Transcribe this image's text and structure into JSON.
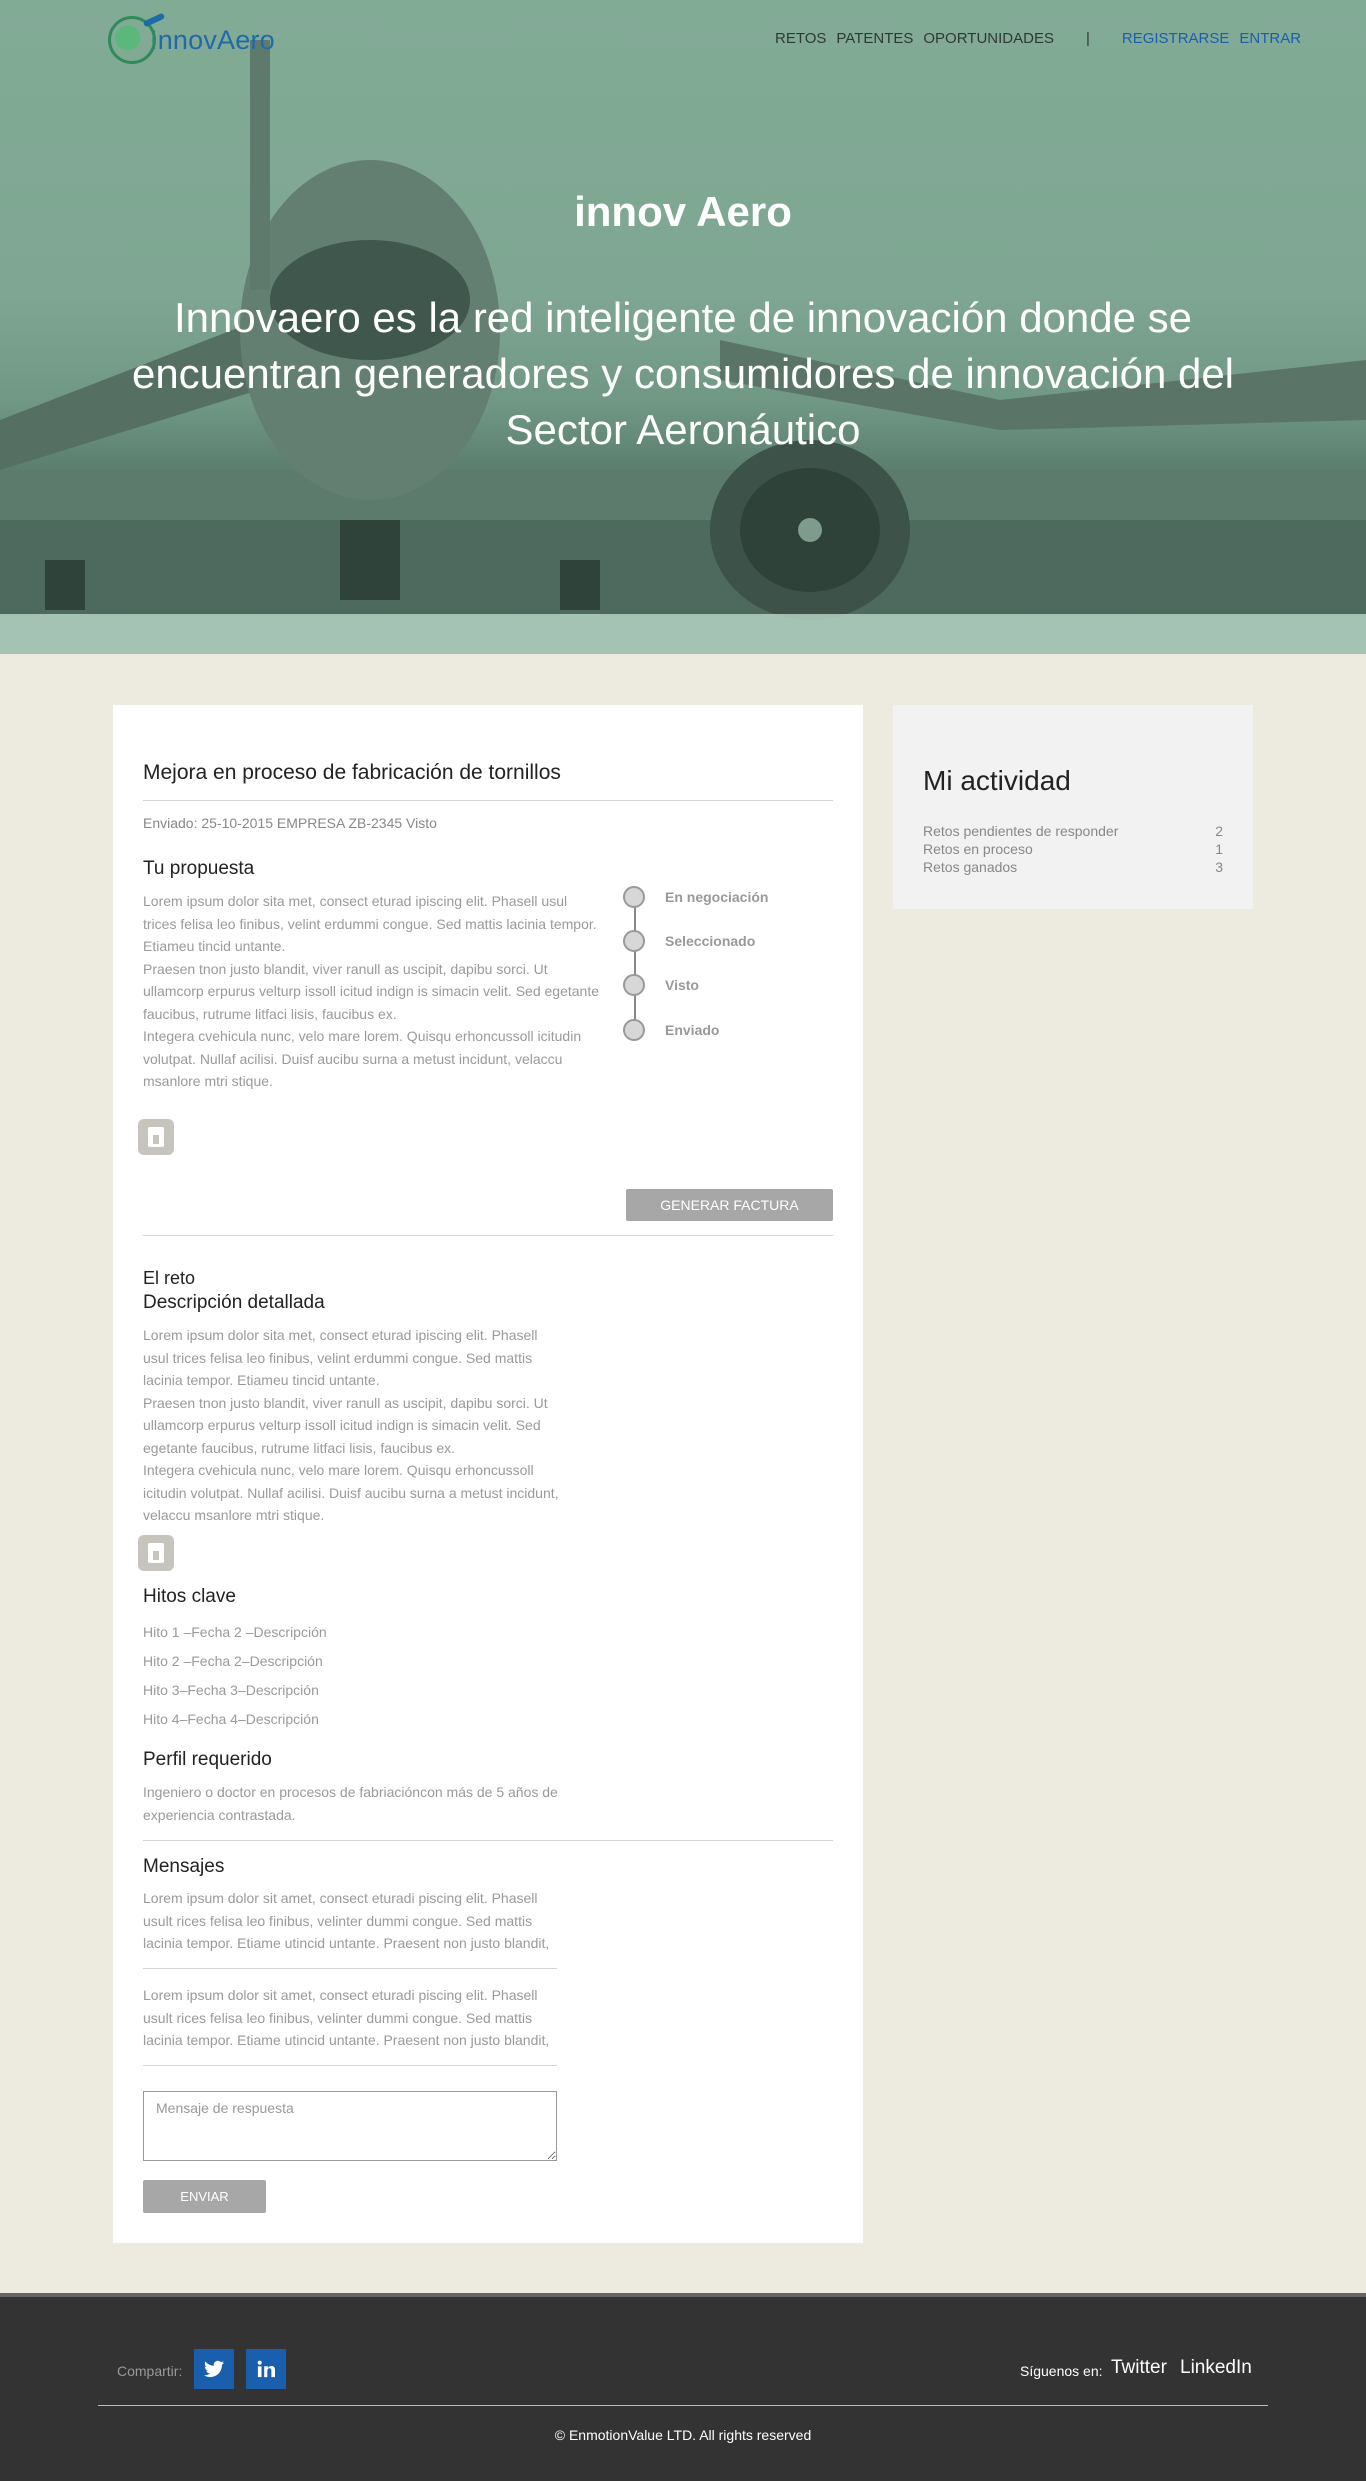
{
  "brand": {
    "logo_text": "InnovAero"
  },
  "nav": {
    "items": [
      "RETOS",
      "PATENTES",
      "OPORTUNIDADES"
    ],
    "separator": "|",
    "register": "REGISTRARSE",
    "login": "ENTRAR"
  },
  "hero": {
    "title": "innov Aero",
    "subtitle": "Innovaero es la red inteligente de innovación donde se encuentran generadores y consumidores de innovación del Sector Aeronáutico"
  },
  "proposal": {
    "title": "Mejora en proceso de fabricación de tornillos",
    "meta": "Enviado: 25-10-2015 EMPRESA ZB-2345 Visto",
    "section_title": "Tu propuesta",
    "text_lines": [
      "Lorem ipsum dolor sita met, consect eturad ipiscing elit. Phasell usul",
      "trices felisa leo finibus, velint erdummi congue. Sed mattis lacinia tempor.",
      "Etiameu tincid untante.",
      "Praesen tnon justo blandit, viver ranull as uscipit, dapibu sorci. Ut",
      "ullamcorp erpurus velturp issoll icitud indign is simacin velit. Sed egetante",
      "faucibus, rutrume litfaci lisis, faucibus ex.",
      "Integera cvehicula nunc, velo mare lorem. Quisqu erhoncussoll icitudin",
      "volutpat. Nullaf acilisi. Duisf aucibu surna a metust incidunt, velaccu",
      "msanlore mtri stique."
    ],
    "status_steps": [
      "En negociación",
      "Seleccionado",
      "Visto",
      "Enviado"
    ],
    "invoice_button": "GENERAR FACTURA"
  },
  "challenge": {
    "label": "El reto",
    "desc_title": "Descripción detallada",
    "desc_lines": [
      "Lorem ipsum dolor sita met, consect eturad ipiscing elit. Phasell",
      "usul trices felisa leo finibus, velint erdummi congue. Sed mattis",
      "lacinia tempor. Etiameu tincid untante.",
      "Praesen tnon justo blandit, viver ranull as uscipit, dapibu sorci. Ut",
      "ullamcorp erpurus velturp issoll icitud indign is simacin velit. Sed",
      "egetante faucibus, rutrume litfaci lisis, faucibus ex.",
      "Integera cvehicula nunc, velo mare lorem. Quisqu erhoncussoll",
      "icitudin volutpat. Nullaf acilisi. Duisf aucibu surna a metust incidunt,",
      "velaccu msanlore mtri stique."
    ],
    "milestones_title": "Hitos clave",
    "milestones": [
      "Hito 1 –Fecha 2 –Descripción",
      "Hito 2 –Fecha 2–Descripción",
      "Hito 3–Fecha 3–Descripción",
      "Hito 4–Fecha 4–Descripción"
    ],
    "profile_title": "Perfil requerido",
    "profile_lines": [
      "Ingeniero o doctor en procesos de fabriacióncon más de 5 años de",
      "experiencia contrastada."
    ]
  },
  "messages": {
    "title": "Mensajes",
    "items": [
      [
        "Lorem ipsum dolor sit amet, consect eturadi piscing elit. Phasell",
        "usult rices felisa leo finibus, velinter dummi congue. Sed mattis",
        "lacinia tempor. Etiame utincid untante. Praesent non justo blandit,"
      ],
      [
        "Lorem ipsum dolor sit amet, consect eturadi piscing elit. Phasell",
        "usult rices felisa leo finibus, velinter dummi congue. Sed mattis",
        "lacinia tempor. Etiame utincid untante. Praesent non justo blandit,"
      ]
    ],
    "reply_placeholder": "Mensaje de respuesta",
    "send_button": "ENVIAR"
  },
  "activity": {
    "title": "Mi actividad",
    "rows": [
      {
        "label": "Retos pendientes de responder",
        "count": "2"
      },
      {
        "label": "Retos en proceso",
        "count": "1"
      },
      {
        "label": "Retos ganados",
        "count": "3"
      }
    ]
  },
  "footer": {
    "share_label": "Compartir:",
    "social_icons": [
      "twitter-icon",
      "linkedin-icon"
    ],
    "follow_label": "Síguenos en:",
    "links": [
      "Twitter",
      "LinkedIn"
    ],
    "copyright": "© EnmotionValue LTD. All rights reserved"
  },
  "colors": {
    "hero_tint": "#82ab96",
    "brand_blue": "#1a5fae",
    "button_gray": "#a7a7a7",
    "footer_bg": "#333333",
    "page_bg": "#edeae0"
  }
}
